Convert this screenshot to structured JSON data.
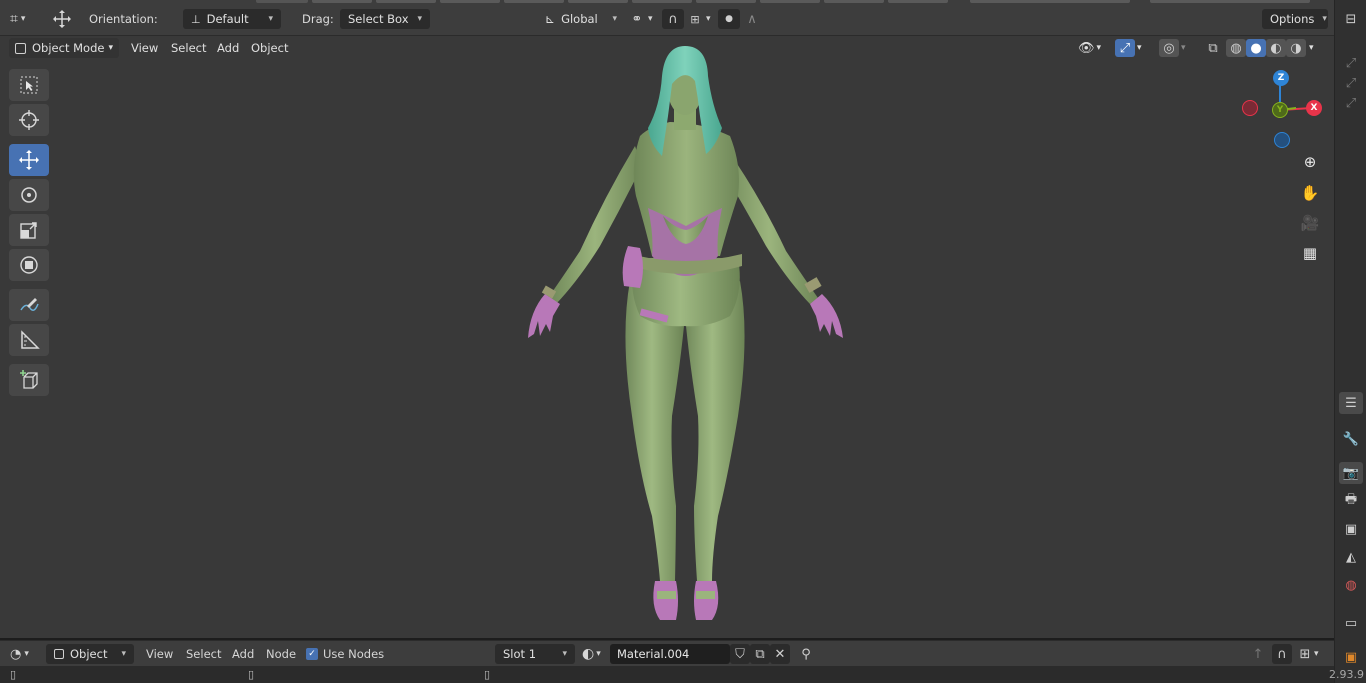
{
  "topbar": {
    "orientation_label": "Orientation:",
    "orientation_value": "Default",
    "drag_label": "Drag:",
    "drag_value": "Select Box",
    "transform_space": "Global",
    "options_label": "Options"
  },
  "viewport_header": {
    "mode": "Object Mode",
    "menus": [
      "View",
      "Select",
      "Add",
      "Object"
    ]
  },
  "tools": [
    {
      "name": "select-box-tool",
      "icon": "select-box-icon",
      "active": false
    },
    {
      "name": "cursor-tool",
      "icon": "cursor-icon",
      "active": false
    },
    {
      "name": "move-tool",
      "icon": "move-icon",
      "active": true
    },
    {
      "name": "rotate-tool",
      "icon": "rotate-icon",
      "active": false
    },
    {
      "name": "scale-tool",
      "icon": "scale-icon",
      "active": false
    },
    {
      "name": "transform-tool",
      "icon": "transform-icon",
      "active": false
    },
    {
      "name": "annotate-tool",
      "icon": "annotate-icon",
      "active": false
    },
    {
      "name": "measure-tool",
      "icon": "measure-icon",
      "active": false
    },
    {
      "name": "add-cube-tool",
      "icon": "add-cube-icon",
      "active": false
    }
  ],
  "gizmo": {
    "z_label": "Z",
    "x_label": "X",
    "y_label": "Y"
  },
  "bottombar": {
    "editor_type": "Object",
    "menus": [
      "View",
      "Select",
      "Add",
      "Node"
    ],
    "use_nodes_label": "Use Nodes",
    "use_nodes_checked": true,
    "slot_value": "Slot 1",
    "material_name": "Material.004"
  },
  "version": "2.93.9",
  "colors": {
    "accent": "#4772b3",
    "viewport_bg": "#393939",
    "header_bg": "#3d3d3d",
    "axis_x": "#e8344a",
    "axis_y": "#86b31d",
    "axis_z": "#2e84d6",
    "skin": "#8aa56e",
    "hair": "#5fbfa4",
    "accessories": "#b878b8"
  }
}
